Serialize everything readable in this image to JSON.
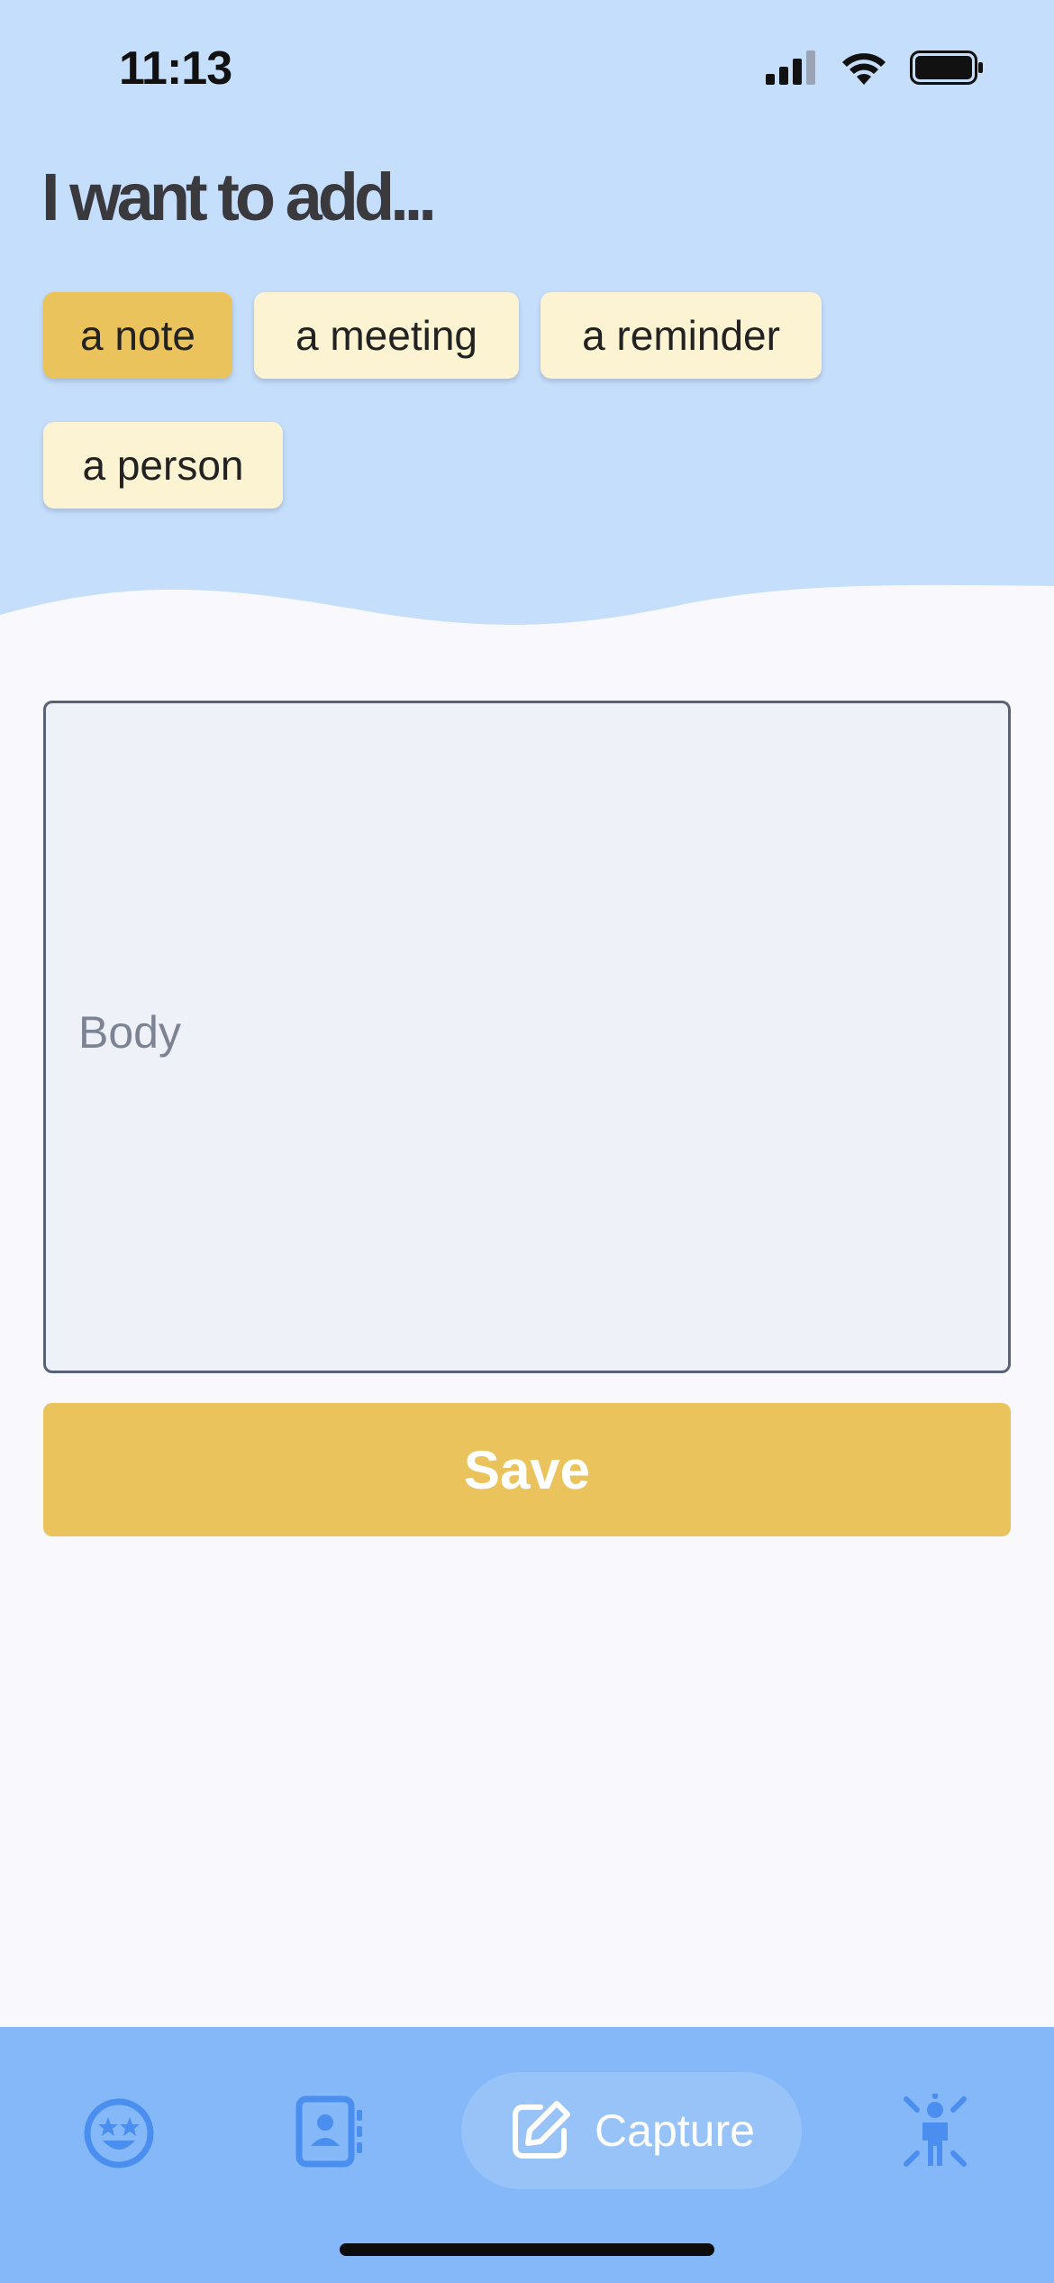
{
  "status_bar": {
    "time": "11:13",
    "signal_icon": "cellular-signal-icon",
    "wifi_icon": "wifi-icon",
    "battery_icon": "battery-icon"
  },
  "header": {
    "title": "I want to add..."
  },
  "type_options": [
    {
      "label": "a note",
      "selected": true
    },
    {
      "label": "a meeting",
      "selected": false
    },
    {
      "label": "a reminder",
      "selected": false
    },
    {
      "label": "a person",
      "selected": false
    }
  ],
  "form": {
    "body_placeholder": "Body",
    "body_value": "",
    "save_label": "Save"
  },
  "tabbar": {
    "tabs": [
      {
        "icon": "star-eyes-face-icon"
      },
      {
        "icon": "contacts-book-icon"
      },
      {
        "icon": "edit-pencil-icon",
        "label": "Capture",
        "active": true
      },
      {
        "icon": "person-radiating-icon"
      }
    ]
  },
  "colors": {
    "header_bg": "#c5defc",
    "accent": "#ebc35c",
    "chip_bg": "#fcf3d3",
    "tabbar_bg": "#84b8f8",
    "tab_icon": "#4a8ef0"
  }
}
